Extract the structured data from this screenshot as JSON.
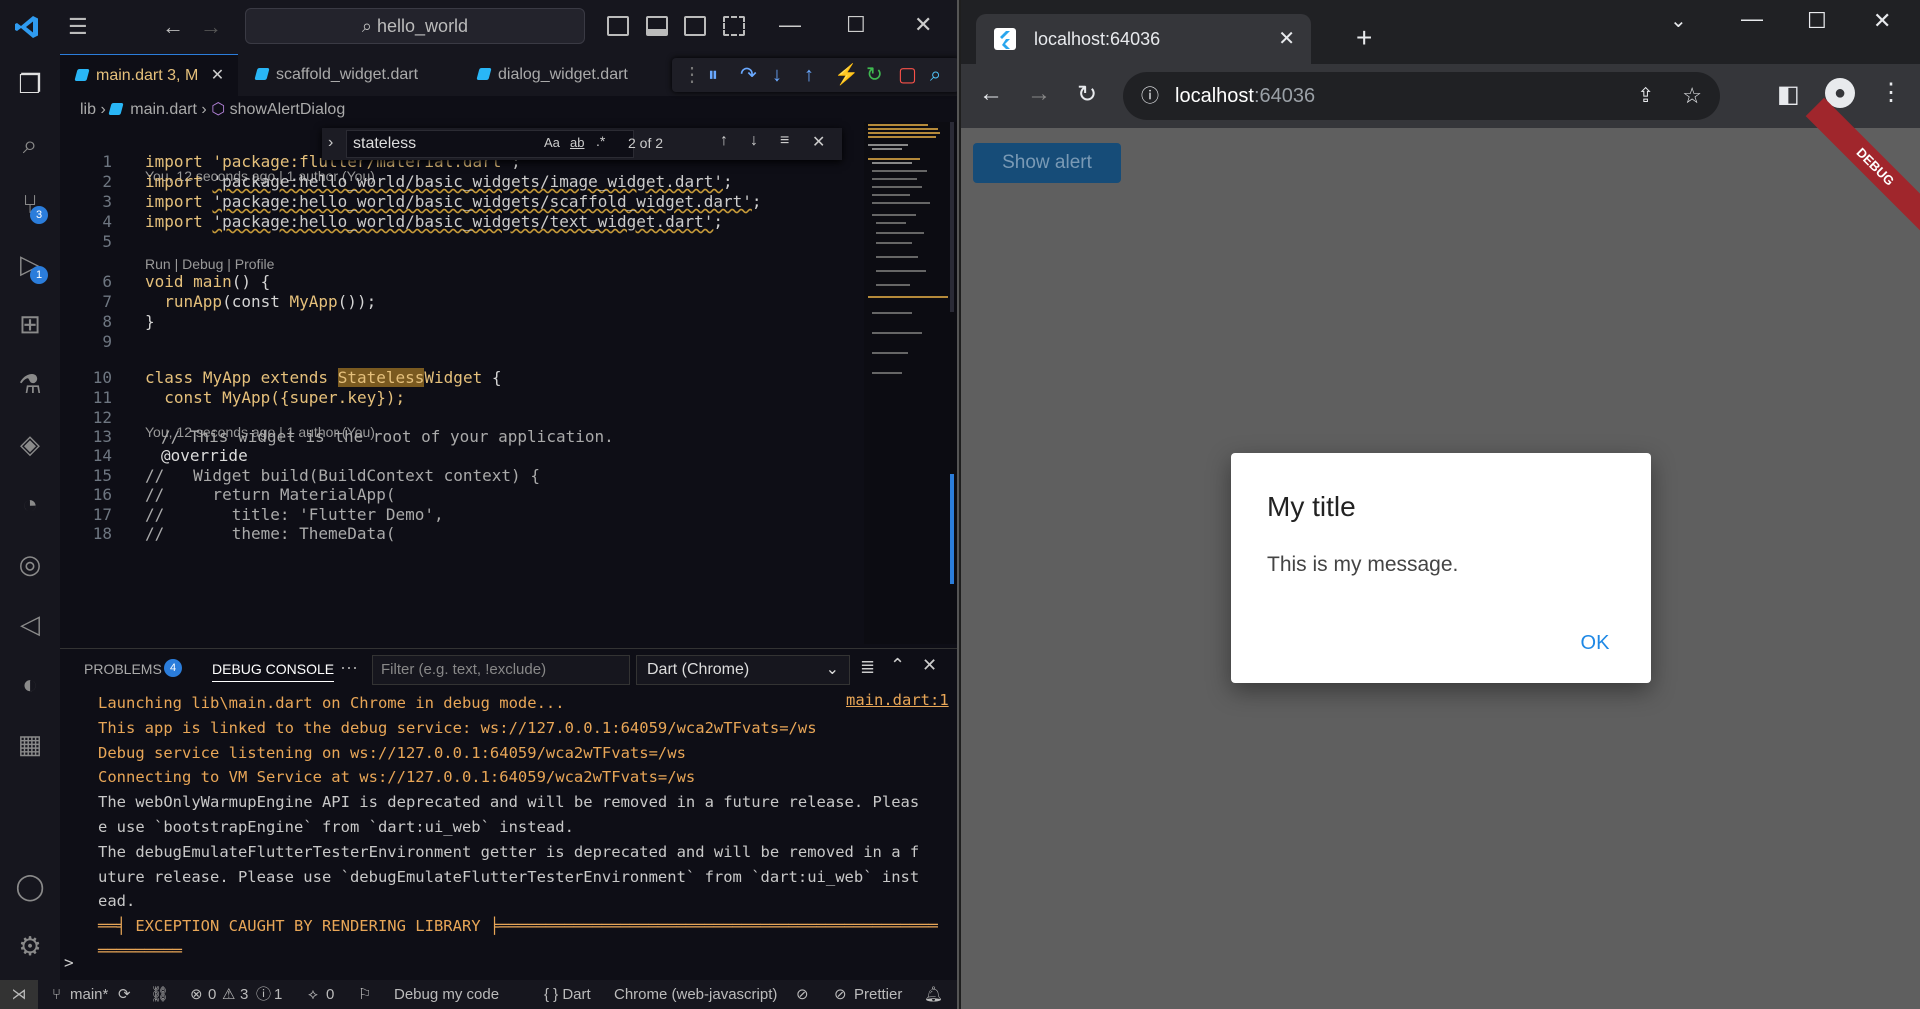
{
  "vscode": {
    "search": "hello_world",
    "tabs": [
      {
        "label": "main.dart",
        "badge": "3, M"
      },
      {
        "label": "scaffold_widget.dart"
      },
      {
        "label": "dialog_widget.dart"
      }
    ],
    "breadcrumb": {
      "folder": "lib",
      "file": "main.dart",
      "symbol": "showAlertDialog"
    },
    "find": {
      "query": "stateless",
      "aa": "Aa",
      "ab": "ab",
      "regex": ".*",
      "count": "2 of 2"
    },
    "badges": {
      "scm": "3",
      "debug": "1"
    },
    "code": {
      "blame1": "You, 12 seconds ago | 1 author (You)",
      "lens": "Run | Debug | Profile",
      "blame2": "You, 12 seconds ago | 1 author (You)",
      "import_kw": "import",
      "imports": [
        "'package:flutter/material.dart'",
        "'package:hello_world/basic_widgets/image_widget.dart'",
        "'package:hello_world/basic_widgets/scaffold_widget.dart'",
        "'package:hello_world/basic_widgets/text_widget.dart'"
      ],
      "semi": ";",
      "l6a": "void",
      "l6b": "main",
      "l6c": "() {",
      "l7a": "runApp",
      "l7b": "(const ",
      "l7c": "MyApp",
      "l7d": "());",
      "l8": "}",
      "l10a": "class",
      "l10b": "MyApp",
      "l10c": "extends",
      "l10d": "Stateless",
      "l10e": "Widget",
      "l10f": "{",
      "l11a": "const",
      "l11b": "MyApp",
      "l11c": "({super.key});",
      "l13": "// This widget is the root of your application.",
      "l14": "@override",
      "l15": "//   Widget build(BuildContext context) {",
      "l16": "//     return MaterialApp(",
      "l17": "//       title: 'Flutter Demo',",
      "l18": "//       theme: ThemeData("
    },
    "line_numbers": [
      "1",
      "2",
      "3",
      "4",
      "5",
      "6",
      "7",
      "8",
      "9",
      "10",
      "11",
      "12",
      "13",
      "14",
      "15",
      "16",
      "17",
      "18"
    ],
    "panel": {
      "problems": "PROBLEMS",
      "problems_count": "4",
      "debug_console": "DEBUG CONSOLE",
      "more": "···",
      "filter_placeholder": "Filter (e.g. text, !exclude)",
      "target": "Dart (Chrome)",
      "source_link": "main.dart:1",
      "lines": [
        {
          "t": "Launching lib\\main.dart on Chrome in debug mode...",
          "c": "o"
        },
        {
          "t": "This app is linked to the debug service: ws://127.0.0.1:64059/wca2wTFvats=/ws",
          "c": "o"
        },
        {
          "t": "Debug service listening on ws://127.0.0.1:64059/wca2wTFvats=/ws",
          "c": "o"
        },
        {
          "t": "Connecting to VM Service at ws://127.0.0.1:64059/wca2wTFvats=/ws",
          "c": "o"
        },
        {
          "t": "The webOnlyWarmupEngine API is deprecated and will be removed in a future release. Pleas",
          "c": "w"
        },
        {
          "t": "e use `bootstrapEngine` from `dart:ui_web` instead.",
          "c": "w"
        },
        {
          "t": "The debugEmulateFlutterTesterEnvironment getter is deprecated and will be removed in a f",
          "c": "w"
        },
        {
          "t": "uture release. Please use `debugEmulateFlutterTesterEnvironment` from `dart:ui_web` inst",
          "c": "w"
        },
        {
          "t": "ead.",
          "c": "w"
        },
        {
          "t": "══╡ EXCEPTION CAUGHT BY RENDERING LIBRARY ╞═══════════════════════════════════════════════",
          "c": "o"
        },
        {
          "t": "═════════",
          "c": "o"
        }
      ],
      "prompt": ">"
    },
    "status": {
      "branch": "main*",
      "errors": "0",
      "warnings": "3",
      "infos": "1",
      "ports": "0",
      "debug": "Debug my code",
      "lang": "{ } Dart",
      "device": "Chrome (web-javascript)",
      "prettier": "Prettier"
    }
  },
  "chrome": {
    "tab_title": "localhost:64036",
    "url_host": "localhost",
    "url_port": ":64036",
    "show_alert": "Show alert",
    "debug_banner": "DEBUG",
    "dialog": {
      "title": "My title",
      "message": "This is my message.",
      "ok": "OK"
    }
  },
  "colors": {
    "accent": "#2b7ddb",
    "debug_banner": "#a0262c",
    "dialog_ok": "#1e88e5"
  }
}
